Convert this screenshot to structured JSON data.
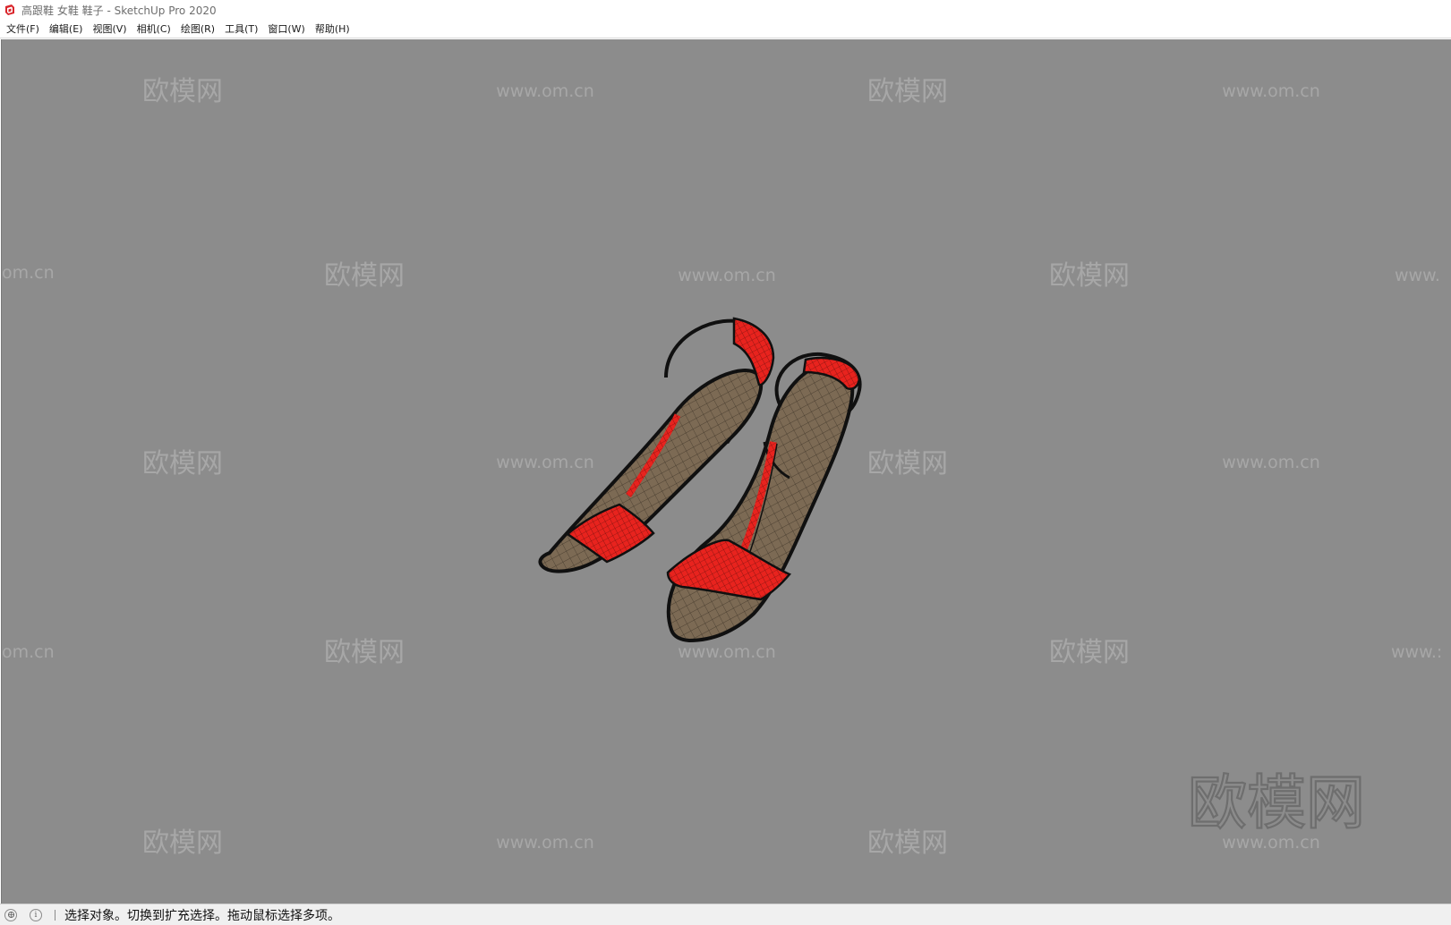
{
  "window": {
    "title": "高跟鞋 女鞋 鞋子 - SketchUp Pro 2020",
    "app_icon": "sketchup-logo-icon",
    "accent_color": "#d9252b"
  },
  "menu": {
    "items": [
      {
        "label": "文件(F)"
      },
      {
        "label": "编辑(E)"
      },
      {
        "label": "视图(V)"
      },
      {
        "label": "相机(C)"
      },
      {
        "label": "绘图(R)"
      },
      {
        "label": "工具(T)"
      },
      {
        "label": "窗口(W)"
      },
      {
        "label": "帮助(H)"
      }
    ]
  },
  "viewport": {
    "background_color": "#8c8c8c",
    "model_color_strap": "#e8231e",
    "model_color_sole": "#7a6650",
    "watermarks": {
      "logo": "欧模网",
      "url": "www.om.cn",
      "partial_url": "om.cn",
      "partial_url_right": "www.",
      "partial_url_right_short": "www.:"
    }
  },
  "status": {
    "geo_icon": "geo-location-icon",
    "info_icon": "info-icon",
    "info_glyph": "i",
    "text": "选择对象。切换到扩充选择。拖动鼠标选择多项。"
  }
}
